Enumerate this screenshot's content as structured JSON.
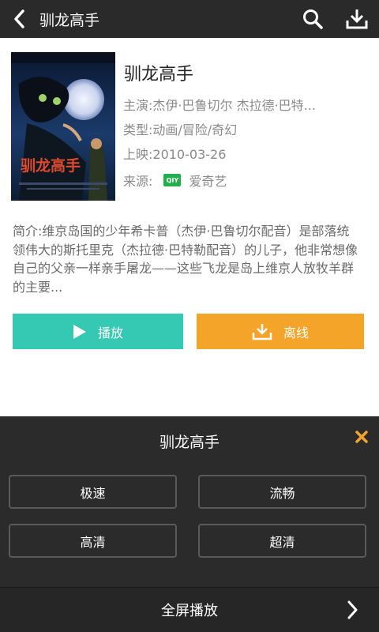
{
  "header": {
    "title": "驯龙高手",
    "back_icon": "back-icon",
    "search_icon": "search-icon",
    "download_icon": "download-icon"
  },
  "movie": {
    "title": "驯龙高手",
    "cast": "主演:杰伊·巴鲁切尔 杰拉德·巴特...",
    "type": "类型:动画/冒险/奇幻",
    "release": "上映:2010-03-26",
    "source_label": "来源:",
    "source_badge": "QIY",
    "source_name": "爱奇艺",
    "poster_title": "驯龙高手",
    "description": "简介:维京岛国的少年希卡普（杰伊·巴鲁切尔配音）是部落统领伟大的斯托里克（杰拉德·巴特勒配音）的儿子，他非常想像自己的父亲一样亲手屠龙——这些飞龙是岛上维京人放牧羊群的主要..."
  },
  "actions": {
    "play_label": "播放",
    "offline_label": "离线"
  },
  "panel": {
    "title": "驯龙高手",
    "close_icon": "close-icon",
    "qualities": [
      "极速",
      "流畅",
      "高清",
      "超清"
    ],
    "fullscreen_label": "全屏播放"
  },
  "colors": {
    "play": "#35c9b4",
    "offline": "#f5a42a",
    "bar": "#2a2a2a",
    "panel": "#2b2b2b"
  }
}
